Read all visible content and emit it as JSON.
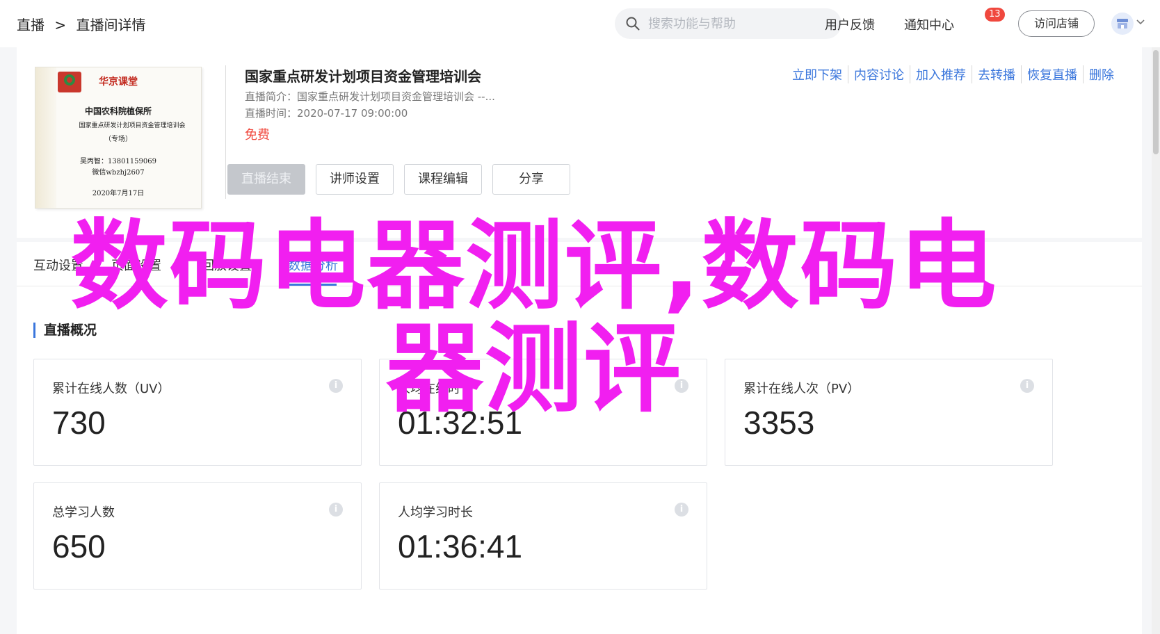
{
  "header": {
    "breadcrumb": [
      "直播",
      ">",
      "直播间详情"
    ],
    "search": {
      "placeholder": "搜索功能与帮助"
    },
    "feedback": "用户反馈",
    "notifications": {
      "label": "通知中心",
      "count": "13"
    },
    "visit_store": "访问店铺"
  },
  "course": {
    "title": "国家重点研发计划项目资金管理培训会",
    "intro": "直播简介：国家重点研发计划项目资金管理培训会 --...",
    "time": "直播时间：2020-07-17 09:00:00",
    "price": "免费",
    "actions": [
      "立即下架",
      "内容讨论",
      "加入推荐",
      "去转播",
      "恢复直播",
      "删除"
    ],
    "buttons": {
      "end_live": "直播结束",
      "teacher_settings": "讲师设置",
      "course_edit": "课程编辑",
      "share": "分享"
    },
    "certificate": {
      "brand": "华京课堂",
      "organization": "中国农科院植保所",
      "subtitle": "国家重点研发计划项目资金管理培训会",
      "type": "（专场）",
      "contact1": "吴丙智：13801159069",
      "contact2": "微信wbzhj2607",
      "date": "2020年7月17日"
    }
  },
  "tabs": [
    {
      "label": "互动设置",
      "active": false
    },
    {
      "label": "页面设置",
      "active": false
    },
    {
      "label": "回放设置",
      "active": false
    },
    {
      "label": "数据分析",
      "active": true
    }
  ],
  "overview": {
    "title": "直播概况",
    "stats": [
      {
        "label": "累计在线人数（UV）",
        "value": "730"
      },
      {
        "label": "人均在线时长",
        "value": "01:32:51"
      },
      {
        "label": "累计在线人次（PV）",
        "value": "3353"
      },
      {
        "label": "总学习人数",
        "value": "650"
      },
      {
        "label": "人均学习时长",
        "value": "01:36:41"
      }
    ]
  },
  "overlay_text": "数码电器测评,数码电器测评",
  "colors": {
    "accent": "#3a76dc",
    "price": "#f0483e",
    "overlay": "#f11ff0"
  }
}
